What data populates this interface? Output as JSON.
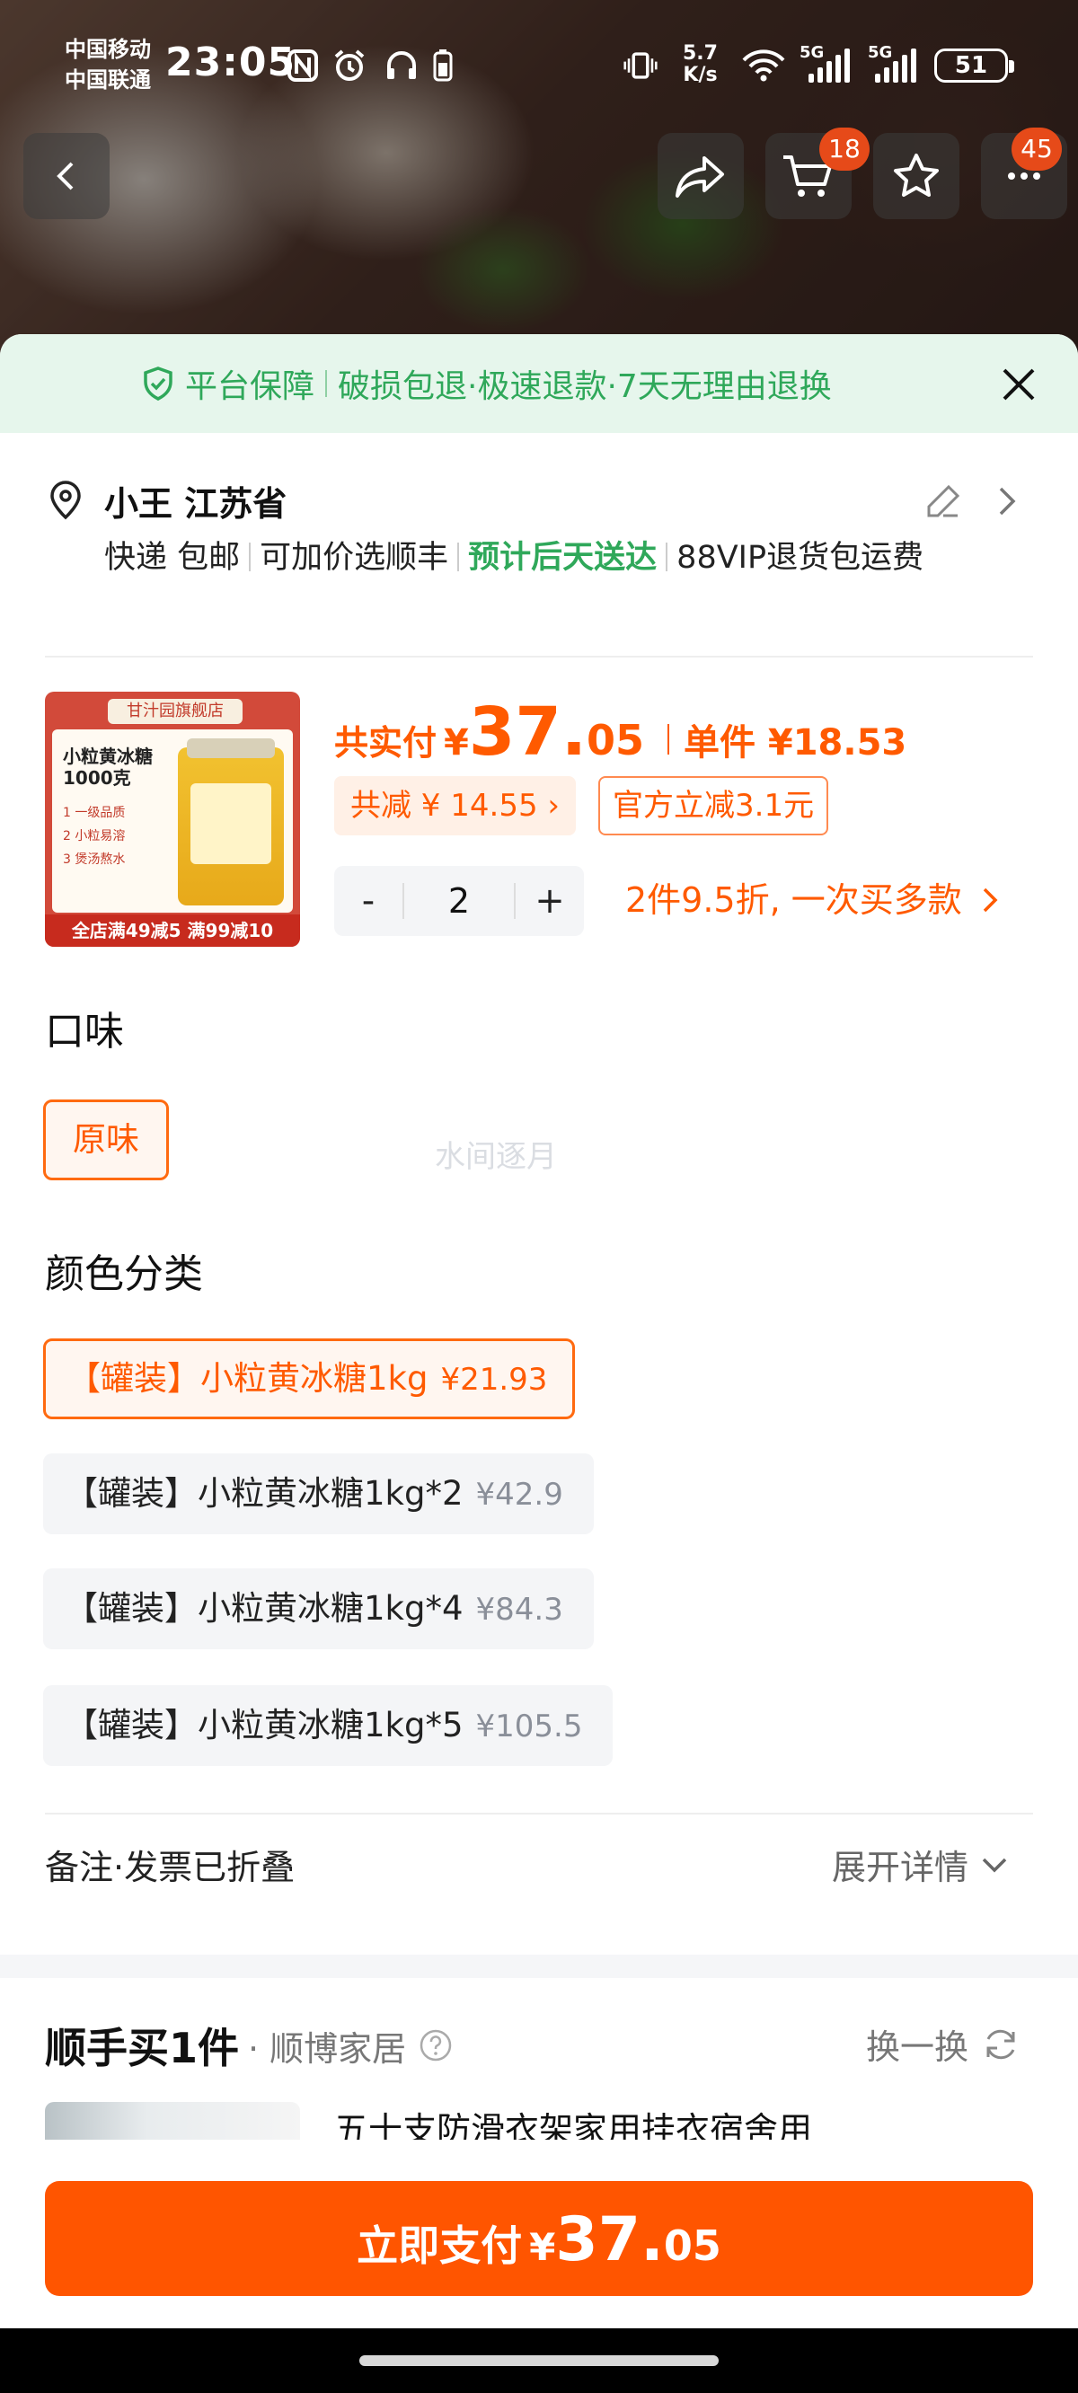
{
  "status_bar": {
    "carrier_1": "中国移动",
    "carrier_2": "中国联通",
    "time": "23:05",
    "net_speed_value": "5.7",
    "net_speed_unit": "K/s",
    "sim1_tag": "5G",
    "sim2_tag": "5G",
    "battery": "51"
  },
  "nav": {
    "cart_badge": "18",
    "more_badge": "45"
  },
  "guarantee": {
    "label": "平台保障",
    "items": [
      "破损包退·极速退款·7天无理由退换"
    ]
  },
  "address": {
    "name": "小王 江苏省",
    "shipping": "快递 包邮",
    "option": "可加价选顺丰",
    "eta": "预计后天送达",
    "extra": "88VIP退货包运费"
  },
  "product": {
    "image_shop": "甘汁园旗舰店",
    "image_name_1": "小粒黄冰糖",
    "image_name_2": "1000克",
    "image_features": [
      "1 一级品质",
      "2 小粒易溶",
      "3 煲汤熬水"
    ],
    "image_promo": "全店满49减5 满99减10",
    "total_label": "共实付",
    "currency": "¥",
    "total_int": "37.",
    "total_dec": "05",
    "unit_label": "单件 ¥18.53",
    "discount_tag": "共减 ¥ 14.55 ›",
    "official_tag": "官方立减3.1元",
    "qty_minus": "-",
    "qty": "2",
    "qty_plus": "+",
    "multi_offer": "2件9.5折, 一次买多款"
  },
  "flavor": {
    "title": "口味",
    "options": [
      "原味"
    ],
    "selected": "原味"
  },
  "watermark": "水间逐月",
  "color_category": {
    "title": "颜色分类",
    "options": [
      {
        "name": "【罐装】小粒黄冰糖1kg",
        "price": "¥21.93"
      },
      {
        "name": "【罐装】小粒黄冰糖1kg*2",
        "price": "¥42.9"
      },
      {
        "name": "【罐装】小粒黄冰糖1kg*4",
        "price": "¥84.3"
      },
      {
        "name": "【罐装】小粒黄冰糖1kg*5",
        "price": "¥105.5"
      }
    ]
  },
  "note": {
    "label": "备注·发票已折叠",
    "expand": "展开详情"
  },
  "recommend": {
    "title": "顺手买1件",
    "subtitle": "· 顺博家居",
    "swap": "换一换",
    "item_title": "五十支防滑衣架家用挂衣宿舍用"
  },
  "pay": {
    "label": "立即支付",
    "currency": "¥",
    "int": "37.",
    "dec": "05"
  },
  "colors": {
    "accent": "#ff5500",
    "green": "#2fa85a"
  }
}
